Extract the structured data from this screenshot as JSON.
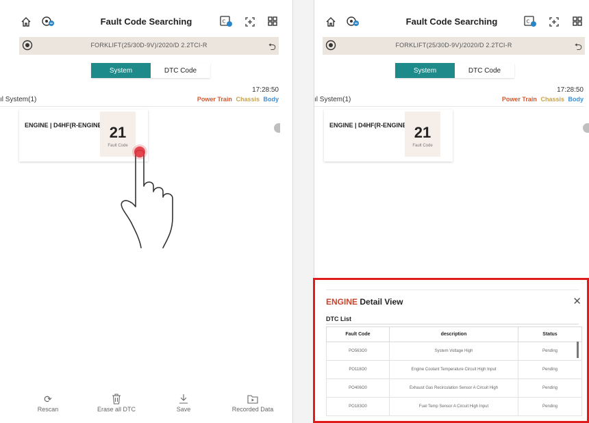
{
  "screens": [
    {
      "header": {
        "title": "Fault Code Searching"
      },
      "vehicle": {
        "label": "FORKLIFT(25/30D-9V)/2020/D 2.2TCI-R"
      },
      "tabs": [
        {
          "label": "System",
          "active": true
        },
        {
          "label": "DTC Code",
          "active": false
        }
      ],
      "timestamp": "17:28:50",
      "system_count_label": "ıl System(1)",
      "filters": [
        {
          "label": "Power Train",
          "color": "#d4582f"
        },
        {
          "label": "Chassis",
          "color": "#c8a24a"
        },
        {
          "label": "Body",
          "color": "#3a8fd6"
        }
      ],
      "cards": [
        {
          "name": "ENGINE | D4HF(R-ENGINE )",
          "count": "21",
          "count_label": "Fault Code"
        }
      ],
      "bottom_actions": [
        {
          "label": "Rescan",
          "icon": "rescan-icon"
        },
        {
          "label": "Erase all DTC",
          "icon": "trash-icon"
        },
        {
          "label": "Save",
          "icon": "download-icon"
        },
        {
          "label": "Recorded Data",
          "icon": "recorded-data-icon"
        }
      ]
    },
    {
      "header": {
        "title": "Fault Code Searching"
      },
      "vehicle": {
        "label": "FORKLIFT(25/30D-9V)/2020/D 2.2TCI-R"
      },
      "tabs": [
        {
          "label": "System",
          "active": true
        },
        {
          "label": "DTC Code",
          "active": false
        }
      ],
      "timestamp": "17:28:50",
      "system_count_label": "ıl System(1)",
      "filters": [
        {
          "label": "Power Train",
          "color": "#d4582f"
        },
        {
          "label": "Chassis",
          "color": "#c8a24a"
        },
        {
          "label": "Body",
          "color": "#3a8fd6"
        }
      ],
      "cards": [
        {
          "name": "ENGINE | D4HF(R-ENGINE )",
          "count": "21",
          "count_label": "Fault Code"
        }
      ]
    }
  ],
  "detail_view": {
    "system": "ENGINE",
    "title": "Detail View",
    "list_label": "DTC List",
    "columns": [
      "Fault Code",
      "description",
      "Status"
    ],
    "rows": [
      [
        "PO563O0",
        "System Voltage High",
        "Pending"
      ],
      [
        "PO118O0",
        "Engine Coolant Temperature Circuit High Input",
        "Pending"
      ],
      [
        "PO406O0",
        "Exhaust Gas Recirculation Sensor A Circuit High",
        "Pending"
      ],
      [
        "PO183O0",
        "Fuel Temp Sensor A Circuit High Input",
        "Pending"
      ]
    ],
    "highlight_color": "#e01b1b"
  },
  "theme": {
    "accent": "#1e8a89",
    "engine_label": "#c9442b",
    "touch_marker": "#e0303a"
  }
}
